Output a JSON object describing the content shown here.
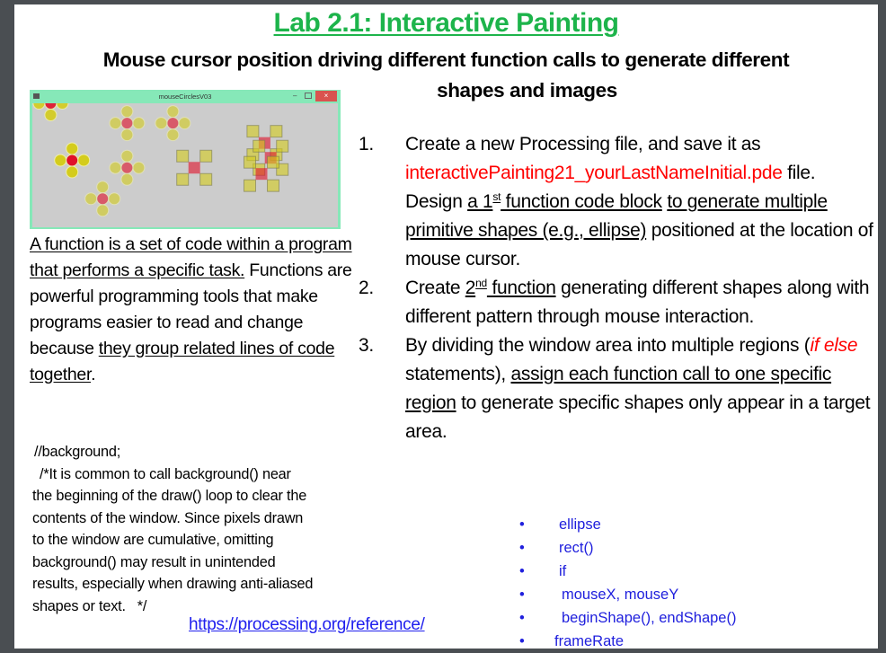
{
  "title": "Lab 2.1: Interactive Painting",
  "subtitle_line1": "Mouse cursor position driving different function calls to generate different",
  "subtitle_line2": "shapes and images",
  "colors": {
    "title_green": "#1db44b",
    "highlight_red": "#ff0000",
    "keyword_blue": "#2020dd",
    "window_frame_green": "#86e8b8",
    "canvas_gray": "#cccccc"
  },
  "processing_window": {
    "title": "mouseCirclesV03",
    "app_icon": "processing-app-icon",
    "minimize_label": "–",
    "close_label": "×",
    "canvas": {
      "circle_clusters": [
        {
          "cx": 0.06,
          "cy": 0.0,
          "opacity": 0.9,
          "partial": true
        },
        {
          "cx": 0.13,
          "cy": 0.46,
          "opacity": 1.0
        },
        {
          "cx": 0.31,
          "cy": 0.16,
          "opacity": 0.6
        },
        {
          "cx": 0.46,
          "cy": 0.16,
          "opacity": 0.6
        },
        {
          "cx": 0.31,
          "cy": 0.52,
          "opacity": 0.6
        },
        {
          "cx": 0.23,
          "cy": 0.77,
          "opacity": 0.6
        }
      ],
      "square_clusters": [
        {
          "cx": 0.53,
          "cy": 0.52
        },
        {
          "cx": 0.76,
          "cy": 0.32
        },
        {
          "cx": 0.78,
          "cy": 0.44
        },
        {
          "cx": 0.75,
          "cy": 0.57
        }
      ]
    }
  },
  "left_paragraph": {
    "underlined_intro": "A function is a set of code within a program that performs a specific task.",
    "plain_middle": " Functions are powerful programming tools that make programs easier to read and change because ",
    "underlined_end": "they group related lines of code together",
    "period": "."
  },
  "steps": [
    {
      "number": "1.",
      "parts": [
        {
          "text": "Create a new Processing file, and save it as ",
          "style": "plain"
        },
        {
          "text": "interactivePainting21_yourLastNameInitial.pde",
          "style": "red"
        },
        {
          "text": " file. Design ",
          "style": "plain"
        },
        {
          "text": "a 1",
          "style": "underline"
        },
        {
          "text": "st",
          "style": "underline-sup"
        },
        {
          "text": " function code block",
          "style": "underline"
        },
        {
          "text": " ",
          "style": "plain"
        },
        {
          "text": "to generate multiple primitive shapes (e.g., ellipse)",
          "style": "underline"
        },
        {
          "text": " positioned at the location of mouse cursor.",
          "style": "plain"
        }
      ]
    },
    {
      "number": "2.",
      "parts": [
        {
          "text": "Create ",
          "style": "plain"
        },
        {
          "text": "2",
          "style": "underline"
        },
        {
          "text": "nd",
          "style": "underline-sup"
        },
        {
          "text": " function",
          "style": "underline"
        },
        {
          "text": " generating different shapes along with different pattern through mouse interaction.",
          "style": "plain"
        }
      ]
    },
    {
      "number": "3.",
      "parts": [
        {
          "text": "By dividing the window area into multiple regions (",
          "style": "plain"
        },
        {
          "text": "if else",
          "style": "red-italic"
        },
        {
          "text": " statements), ",
          "style": "plain"
        },
        {
          "text": "assign each function call to one specific region",
          "style": "underline"
        },
        {
          "text": " to generate specific shapes only appear in a target area.",
          "style": "plain"
        }
      ]
    }
  ],
  "comment_block": {
    "line1": "//background;",
    "line2": "/*It is common to call background() near",
    "line3": "the beginning of the draw() loop to clear the",
    "line4": "contents of the window. Since pixels drawn",
    "line5": "to the window are cumulative, omitting",
    "line6": "background() may result in unintended",
    "line7": "results, especially when drawing anti-aliased",
    "line8": "shapes or text.   */"
  },
  "reference_link": "https://processing.org/reference/",
  "keywords": {
    "bullet": "•",
    "items": [
      "ellipse",
      "rect()",
      "if",
      "mouseX, mouseY",
      "beginShape(), endShape()",
      "frameRate"
    ]
  }
}
